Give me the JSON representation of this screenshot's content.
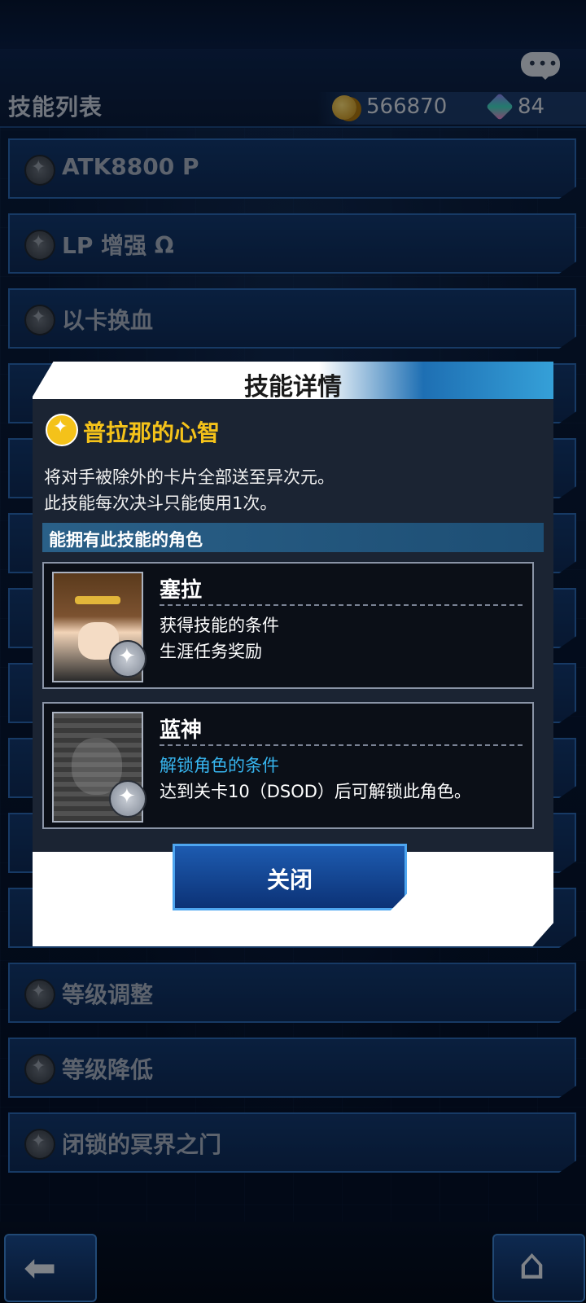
{
  "header": {
    "title": "技能列表",
    "coins": "566870",
    "gems": "84",
    "coin_icon": "coin-icon",
    "gem_icon": "gem-icon",
    "chat_icon": "chat-icon"
  },
  "skills": [
    {
      "label": "ATK8800 P"
    },
    {
      "label": "LP 增强 Ω"
    },
    {
      "label": "以卡换血"
    },
    {
      "label": "等级调整"
    },
    {
      "label": "等级降低"
    },
    {
      "label": "闭锁的冥界之门"
    }
  ],
  "modal": {
    "title": "技能详情",
    "skill_name": "普拉那的心智",
    "description_line1": "将对手被除外的卡片全部送至异次元。",
    "description_line2": "此技能每次决斗只能使用1次。",
    "section_label": "能拥有此技能的角色",
    "characters": [
      {
        "name": "塞拉",
        "condition_label": "获得技能的条件",
        "condition_value": "生涯任务奖励"
      },
      {
        "name": "蓝神",
        "condition_label": "解锁角色的条件",
        "condition_value": "达到关卡10（DSOD）后可解锁此角色。"
      }
    ],
    "close_label": "关闭"
  },
  "footer": {
    "back_icon": "back-arrow-icon",
    "home_icon": "home-icon"
  },
  "colors": {
    "accent_gold": "#f4c21a",
    "accent_blue": "#37b6f0",
    "panel_dark": "#1b2433"
  }
}
